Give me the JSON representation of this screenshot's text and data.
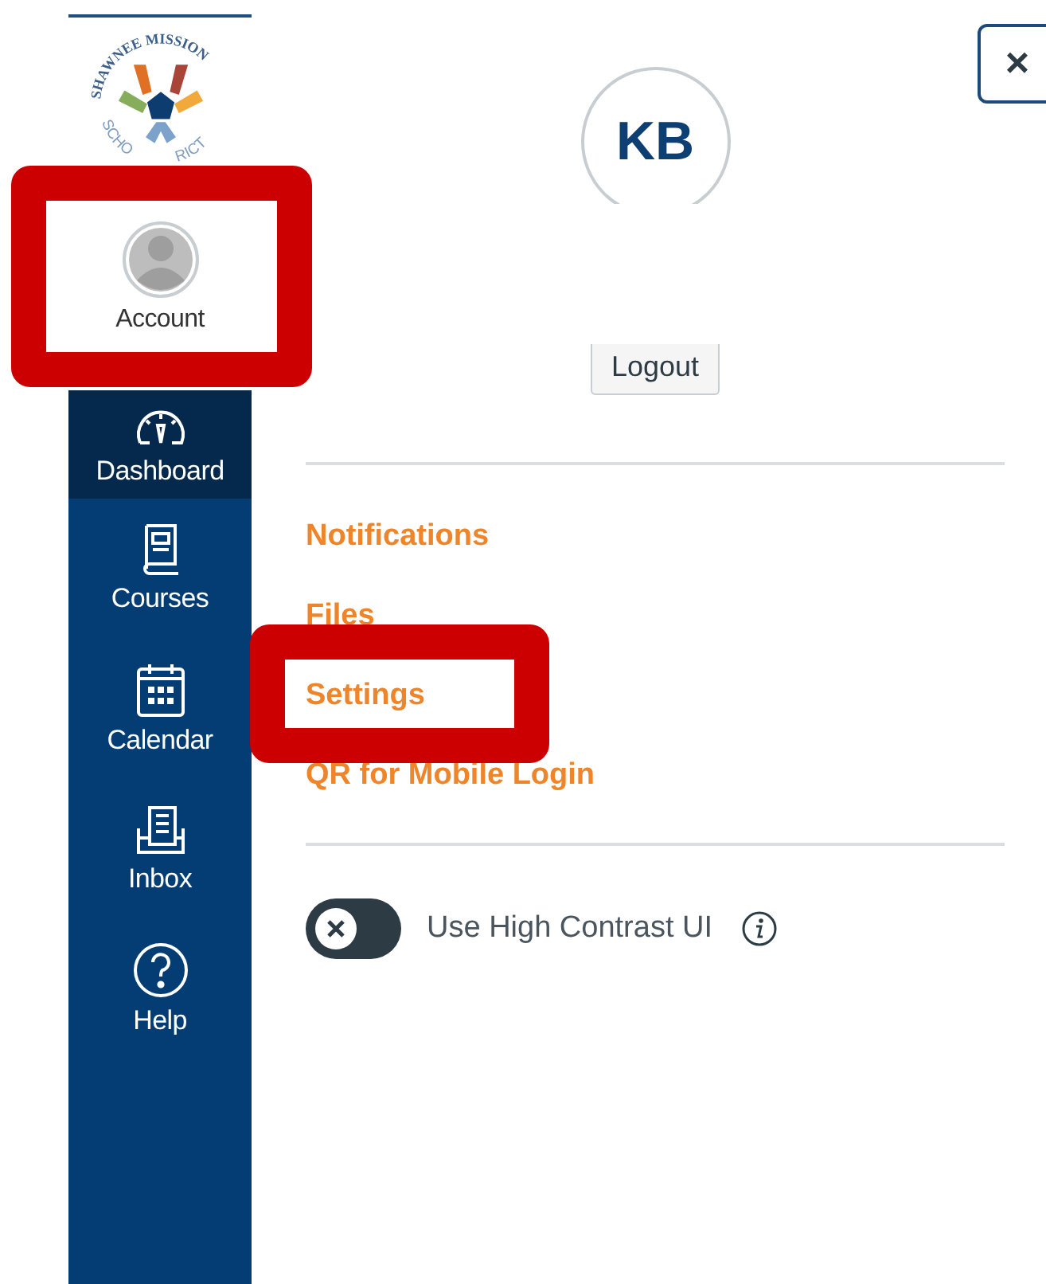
{
  "logo": {
    "top_text": "SHAWNEE MISSION",
    "bottom_left_text": "SCHO",
    "bottom_right_text": "RICT"
  },
  "sidebar": {
    "items": [
      {
        "label": "Account",
        "kind": "avatar",
        "selected": false,
        "highlighted": true
      },
      {
        "label": "Dashboard",
        "kind": "gauge",
        "selected": true,
        "highlighted": false
      },
      {
        "label": "Courses",
        "kind": "book",
        "selected": false,
        "highlighted": false
      },
      {
        "label": "Calendar",
        "kind": "calendar",
        "selected": false,
        "highlighted": false
      },
      {
        "label": "Inbox",
        "kind": "inbox",
        "selected": false,
        "highlighted": false
      },
      {
        "label": "Help",
        "kind": "help",
        "selected": false,
        "highlighted": false
      }
    ]
  },
  "panel": {
    "close_label": "×",
    "avatar_initials": "KB",
    "logout_label": "Logout",
    "links": [
      {
        "label": "Notifications",
        "highlighted": false
      },
      {
        "label": "Files",
        "highlighted": false
      },
      {
        "label": "Settings",
        "highlighted": true
      },
      {
        "label": "QR for Mobile Login",
        "highlighted": false
      }
    ],
    "toggle": {
      "label": "Use High Contrast UI",
      "on": false
    }
  }
}
